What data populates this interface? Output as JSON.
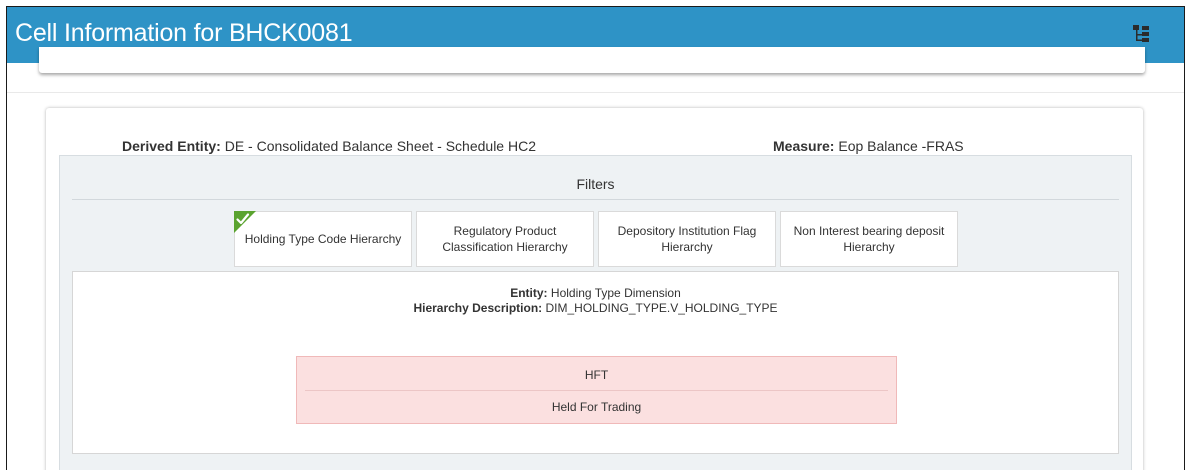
{
  "header": {
    "title": "Cell Information for BHCK0081",
    "hierarchy_icon": "hierarchy-tree-icon",
    "bg_color": "#2e93c6"
  },
  "summary": {
    "entity_label": "Derived Entity:",
    "entity_value": "DE - Consolidated Balance Sheet - Schedule HC2",
    "measure_label": "Measure:",
    "measure_value": "Eop Balance -FRAS"
  },
  "filters": {
    "title": "Filters",
    "tabs": [
      {
        "label": "Holding Type Code Hierarchy",
        "selected": true
      },
      {
        "label": "Regulatory Product Classification Hierarchy",
        "selected": false
      },
      {
        "label": "Depository Institution Flag Hierarchy",
        "selected": false
      },
      {
        "label": "Non Interest bearing deposit Hierarchy",
        "selected": false
      }
    ],
    "selected_badge_icon": "checkmark-icon",
    "selected_badge_color": "#5aa32f"
  },
  "detail": {
    "entity_label": "Entity:",
    "entity_value": "Holding Type Dimension",
    "hierarchy_label": "Hierarchy Description:",
    "hierarchy_value": "DIM_HOLDING_TYPE.V_HOLDING_TYPE",
    "value": {
      "code": "HFT",
      "description": "Held For Trading",
      "bg_color": "#fbe0e0"
    }
  }
}
